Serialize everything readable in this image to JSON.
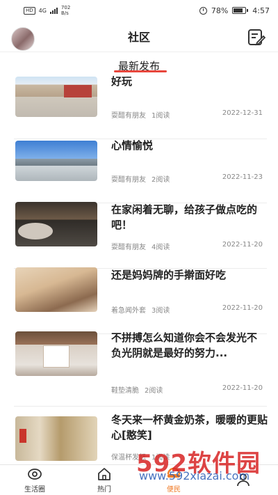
{
  "status_bar": {
    "network_badge": "HD",
    "signal_label": "4G",
    "net_speed_value": "702",
    "net_speed_unit": "B/s",
    "battery_percent": "78%",
    "time": "4:57"
  },
  "header": {
    "title": "社区"
  },
  "section": {
    "title": "最新发布"
  },
  "posts": [
    {
      "title": "好玩",
      "author": "耍醋有朋友",
      "reads": "1阅读",
      "date": "2022-12-31"
    },
    {
      "title": "心情愉悦",
      "author": "耍醋有朋友",
      "reads": "2阅读",
      "date": "2022-11-23"
    },
    {
      "title": "在家闲着无聊，给孩子做点吃的吧！",
      "author": "耍醋有朋友",
      "reads": "4阅读",
      "date": "2022-11-20"
    },
    {
      "title": "还是妈妈牌的手擀面好吃",
      "author": "着急闻外套",
      "reads": "3阅读",
      "date": "2022-11-20"
    },
    {
      "title": "不拼搏怎么知道你会不会发光不负光阴就是最好的努力...",
      "author": "鞋垫清脆",
      "reads": "2阅读",
      "date": "2022-11-20"
    },
    {
      "title": "冬天来一杯黄金奶茶，暖暖的更贴心[憨笑]",
      "author": "保温杯发怒",
      "reads": "1阅读",
      "date": ""
    }
  ],
  "nav": [
    {
      "label": "生活圈",
      "icon": "eye-icon"
    },
    {
      "label": "热门",
      "icon": "home-icon"
    },
    {
      "label": "便民",
      "icon": "service-icon"
    },
    {
      "label": "",
      "icon": "user-icon"
    }
  ],
  "watermark": {
    "brand": "592软件园",
    "url": "www.592xiazai.com"
  }
}
